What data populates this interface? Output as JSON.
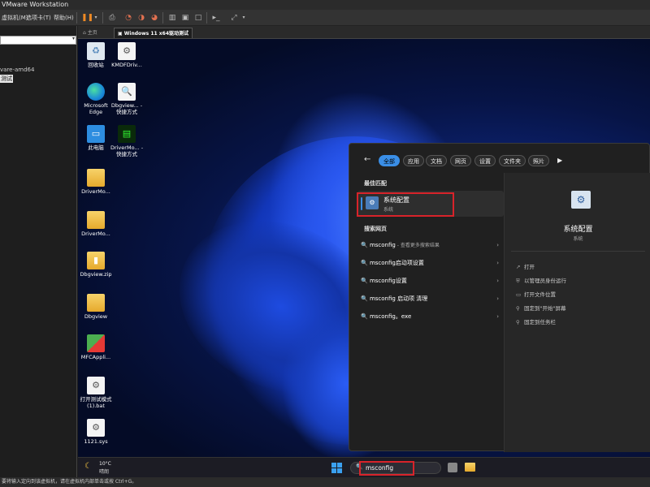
{
  "window": {
    "title": "VMware Workstation"
  },
  "menu": {
    "items": [
      "虚拟机(M)",
      "选项卡(T)",
      "帮助(H)"
    ]
  },
  "library": {
    "item1": "vare-amd64",
    "item2": "测试"
  },
  "tabs": {
    "home": "主页",
    "vm": "Windows 11 x64驱动测试"
  },
  "desktop_icons": [
    {
      "label": "回收站",
      "icon": "recycle-bin-icon"
    },
    {
      "label": "KMDFDriv...",
      "icon": "file-icon"
    },
    {
      "label": "Microsoft Edge",
      "icon": "edge-icon"
    },
    {
      "label": "Dbgview... - 快捷方式",
      "icon": "shortcut-icon"
    },
    {
      "label": "此电脑",
      "icon": "computer-icon"
    },
    {
      "label": "DriverMo... - 快捷方式",
      "icon": "terminal-icon"
    },
    {
      "label": "DriverMo...",
      "icon": "folder-icon"
    },
    {
      "label": "DriverMo...",
      "icon": "folder-icon"
    },
    {
      "label": "Dbgview.zip",
      "icon": "zip-folder-icon"
    },
    {
      "label": "Dbgview",
      "icon": "folder-icon"
    },
    {
      "label": "MFCAppli...",
      "icon": "mfc-app-icon"
    },
    {
      "label": "打开测试模式(1).bat",
      "icon": "bat-file-icon"
    },
    {
      "label": "1121.sys",
      "icon": "sys-file-icon"
    }
  ],
  "search_panel": {
    "filters": [
      "全部",
      "应用",
      "文档",
      "网页",
      "设置",
      "文件夹",
      "照片"
    ],
    "best_match_title": "最佳匹配",
    "best_match": {
      "name": "系统配置",
      "type": "系统"
    },
    "web_title": "搜索网页",
    "web_results": [
      {
        "bold": "msconfig",
        "rest": " - 查看更多搜索结果"
      },
      {
        "bold": "msconfig启动项设置",
        "rest": ""
      },
      {
        "bold": "msconfig设置",
        "rest": ""
      },
      {
        "bold": "msconfig 启动项 清理",
        "rest": ""
      },
      {
        "bold": "msconfig。exe",
        "rest": ""
      }
    ],
    "detail": {
      "name": "系统配置",
      "type": "系统"
    },
    "actions": [
      "打开",
      "以管理员身份运行",
      "打开文件位置",
      "固定到\"开始\"屏幕",
      "固定到任务栏"
    ]
  },
  "taskbar": {
    "weather_temp": "10°C",
    "weather_desc": "晴朗",
    "search_text": "msconfig"
  },
  "statusbar": {
    "text": "要将输入定向到该虚拟机，请在虚拟机内部单击或按 Ctrl+G。"
  },
  "colors": {
    "accent": "#3a8ee6",
    "highlight": "#d8232a"
  }
}
